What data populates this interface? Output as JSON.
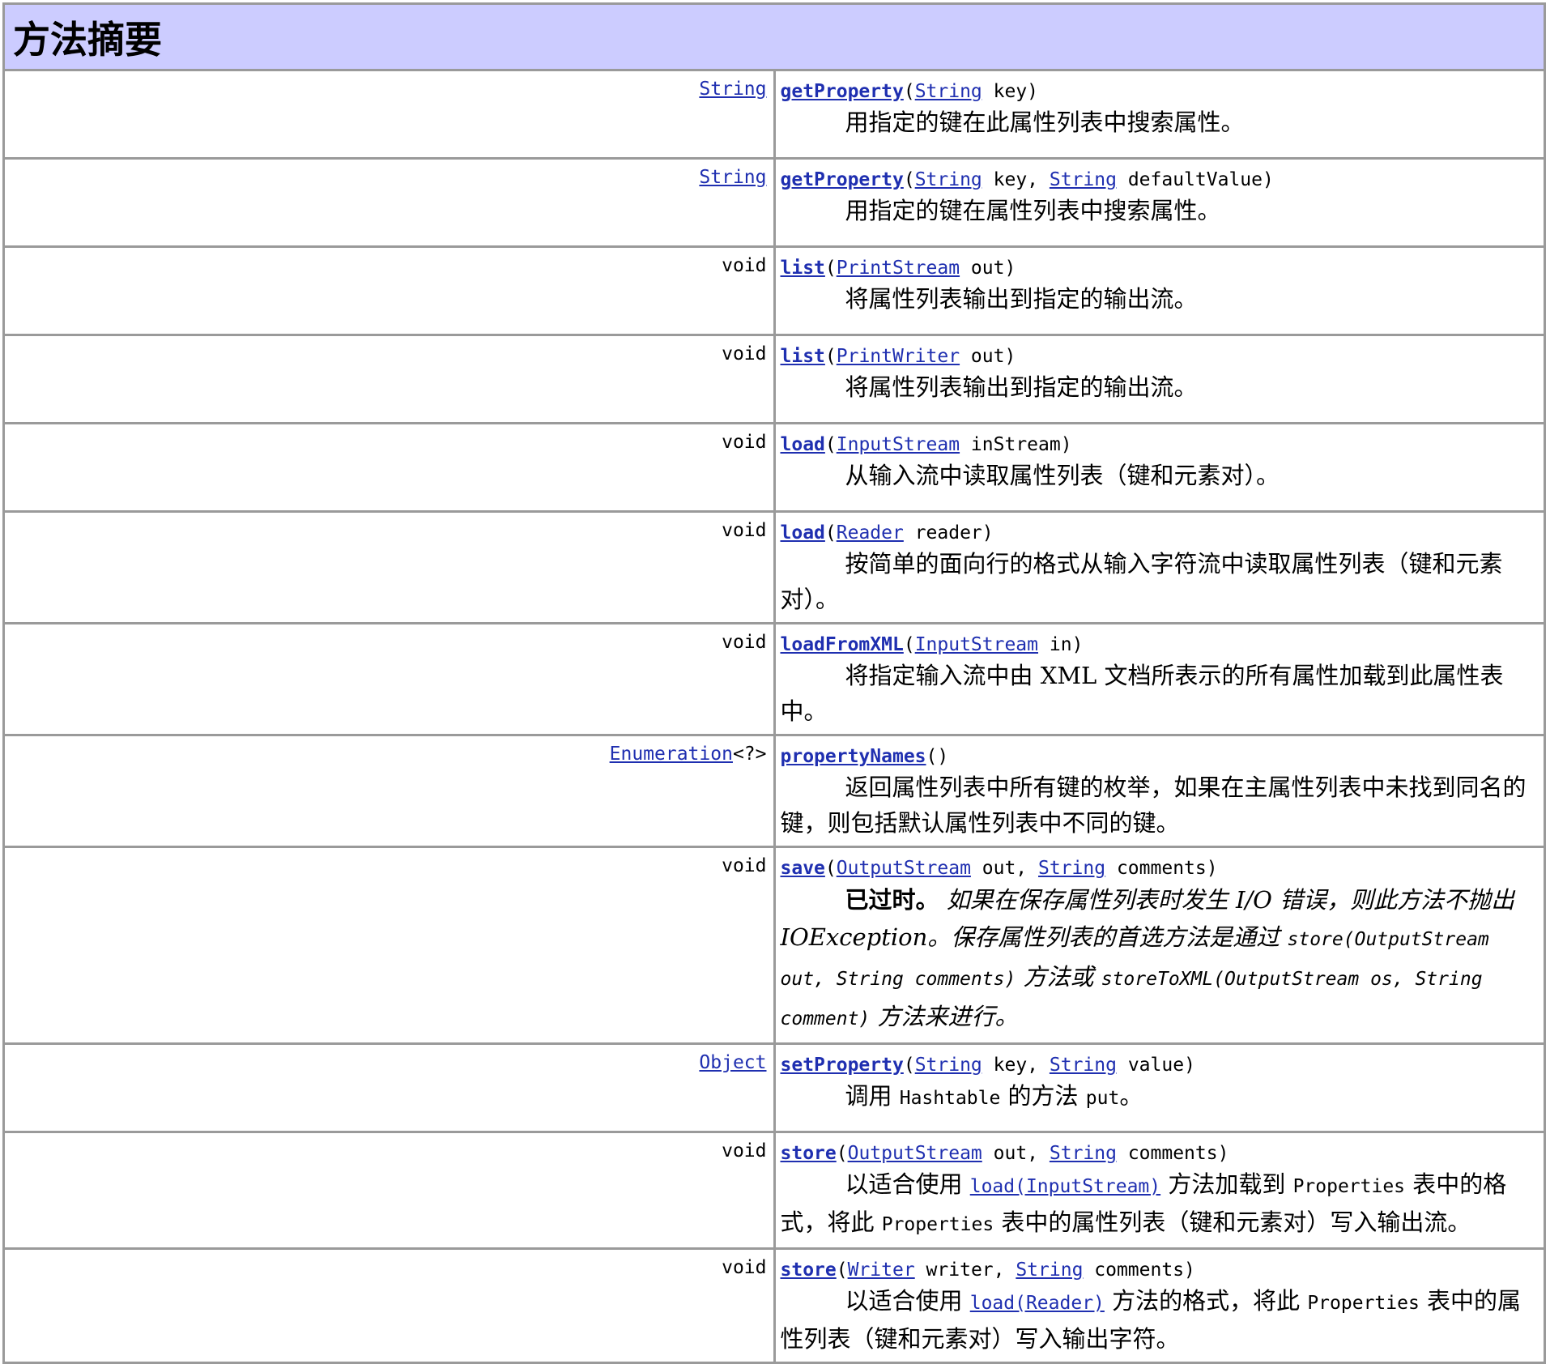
{
  "section_title": "方法摘要",
  "rows": [
    {
      "ret": "String",
      "ret_link": true,
      "name": "getProperty",
      "p1_type": "String",
      "p1_name": " key",
      "desc": "用指定的键在此属性列表中搜索属性。"
    },
    {
      "ret": "String",
      "ret_link": true,
      "name": "getProperty",
      "p1_type": "String",
      "p1_name": " key, ",
      "p2_type": "String",
      "p2_name": " defaultValue",
      "desc": "用指定的键在属性列表中搜索属性。"
    },
    {
      "ret": "void",
      "name": "list",
      "p1_type": "PrintStream",
      "p1_name": " out",
      "desc": "将属性列表输出到指定的输出流。"
    },
    {
      "ret": "void",
      "name": "list",
      "p1_type": "PrintWriter",
      "p1_name": " out",
      "desc": "将属性列表输出到指定的输出流。"
    },
    {
      "ret": "void",
      "name": "load",
      "p1_type": "InputStream",
      "p1_name": " inStream",
      "desc": "从输入流中读取属性列表（键和元素对）。"
    },
    {
      "ret": "void",
      "name": "load",
      "p1_type": "Reader",
      "p1_name": " reader",
      "desc": "按简单的面向行的格式从输入字符流中读取属性列表（键和元素对）。"
    },
    {
      "ret": "void",
      "name": "loadFromXML",
      "p1_type": "InputStream",
      "p1_name": " in",
      "desc": "将指定输入流中由 XML 文档所表示的所有属性加载到此属性表中。"
    },
    {
      "ret": "Enumeration",
      "ret_suffix": "<?>",
      "ret_link": true,
      "name": "propertyNames",
      "desc": "返回属性列表中所有键的枚举，如果在主属性列表中未找到同名的键，则包括默认属性列表中不同的键。"
    },
    {
      "ret": "void",
      "name": "save",
      "p1_type": "OutputStream",
      "p1_name": " out, ",
      "p2_type": "String",
      "p2_name": " comments",
      "deprecated_label": "已过时。",
      "desc_a": " 如果在保存属性列表时发生 I/O 错误，则此方法不抛出 IOException。保存属性列表的首选方法是通过 ",
      "code_a": "store(OutputStream out, String comments)",
      "desc_b": " 方法或 ",
      "code_b": "storeToXML(OutputStream os, String comment)",
      "desc_c": " 方法来进行。"
    },
    {
      "ret": "Object",
      "ret_link": true,
      "name": "setProperty",
      "p1_type": "String",
      "p1_name": " key, ",
      "p2_type": "String",
      "p2_name": " value",
      "desc_a": "调用 ",
      "code_a": "Hashtable",
      "desc_b": " 的方法 ",
      "code_b": "put",
      "desc_c": "。"
    },
    {
      "ret": "void",
      "name": "store",
      "p1_type": "OutputStream",
      "p1_name": " out, ",
      "p2_type": "String",
      "p2_name": " comments",
      "desc_a": "以适合使用 ",
      "link_a": "load(InputStream)",
      "desc_b": " 方法加载到 ",
      "code_a": "Properties",
      "desc_c": " 表中的格式，将此 ",
      "code_b": "Properties",
      "desc_d": " 表中的属性列表（键和元素对）写入输出流。"
    },
    {
      "ret": "void",
      "name": "store",
      "p1_type": "Writer",
      "p1_name": " writer, ",
      "p2_type": "String",
      "p2_name": " comments",
      "desc_a": "以适合使用 ",
      "link_a": "load(Reader)",
      "desc_b": " 方法的格式，将此 ",
      "code_a": "Properties",
      "desc_c": " 表中的属性列表（键和元素对）写入输出字符。"
    }
  ]
}
